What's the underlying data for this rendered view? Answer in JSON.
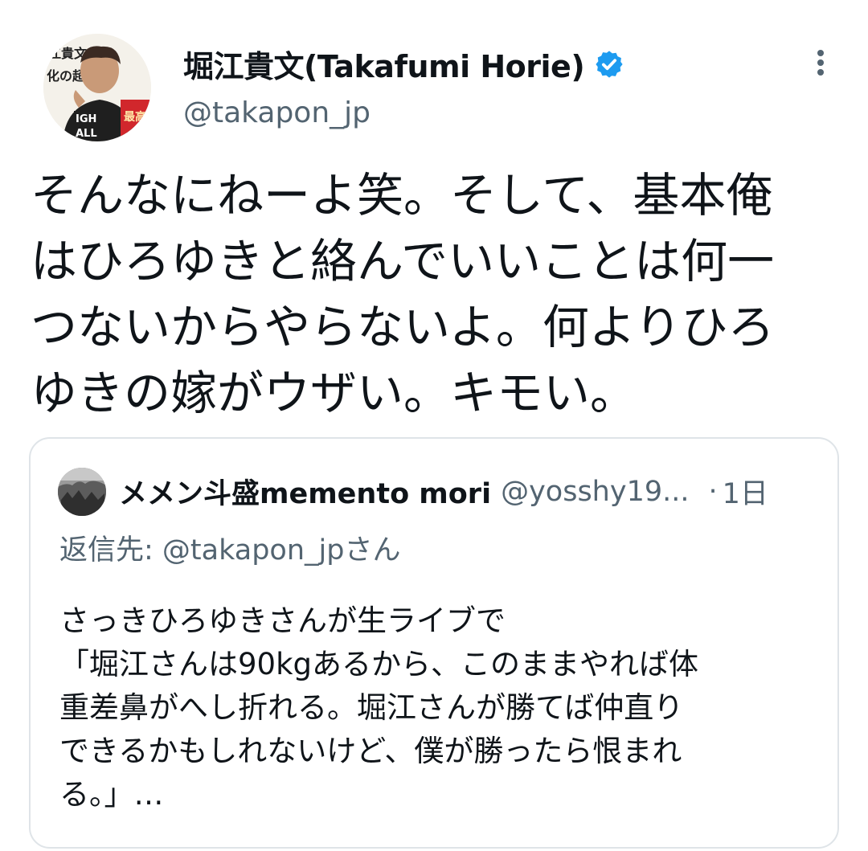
{
  "author": {
    "display_name": "堀江貴文(Takafumi Horie)",
    "handle": "@takapon_jp",
    "verified": true,
    "avatar_lettering": [
      "江貴文",
      "化の超",
      "最高",
      "IGH",
      "ALL"
    ]
  },
  "tweet": {
    "lines": [
      "そんなにねーよ笑。そして、基本俺",
      "はひろゆきと絡んでいいことは何一",
      "つないからやらないよ。何よりひろ",
      "ゆきの嫁がウザい。キモい。"
    ]
  },
  "quoted_tweet": {
    "display_name": "メメン斗盛memento mori",
    "handle": "@yosshy19...",
    "separator": "·",
    "time": "1日",
    "reply_to": "返信先: @takapon_jpさん",
    "lines": [
      "さっきひろゆきさんが生ライブで",
      "「堀江さんは90kgあるから、このままやれば体",
      "重差鼻がへし折れる。堀江さんが勝てば仲直り",
      "できるかもしれないけど、僕が勝ったら恨まれ",
      "る。」…"
    ]
  },
  "icons": {
    "verified": "verified-badge-icon",
    "more": "more-options-icon"
  },
  "colors": {
    "text": "#0f1419",
    "secondary": "#536471",
    "verified_blue": "#1d9bf0",
    "border": "#dfe4e8"
  }
}
